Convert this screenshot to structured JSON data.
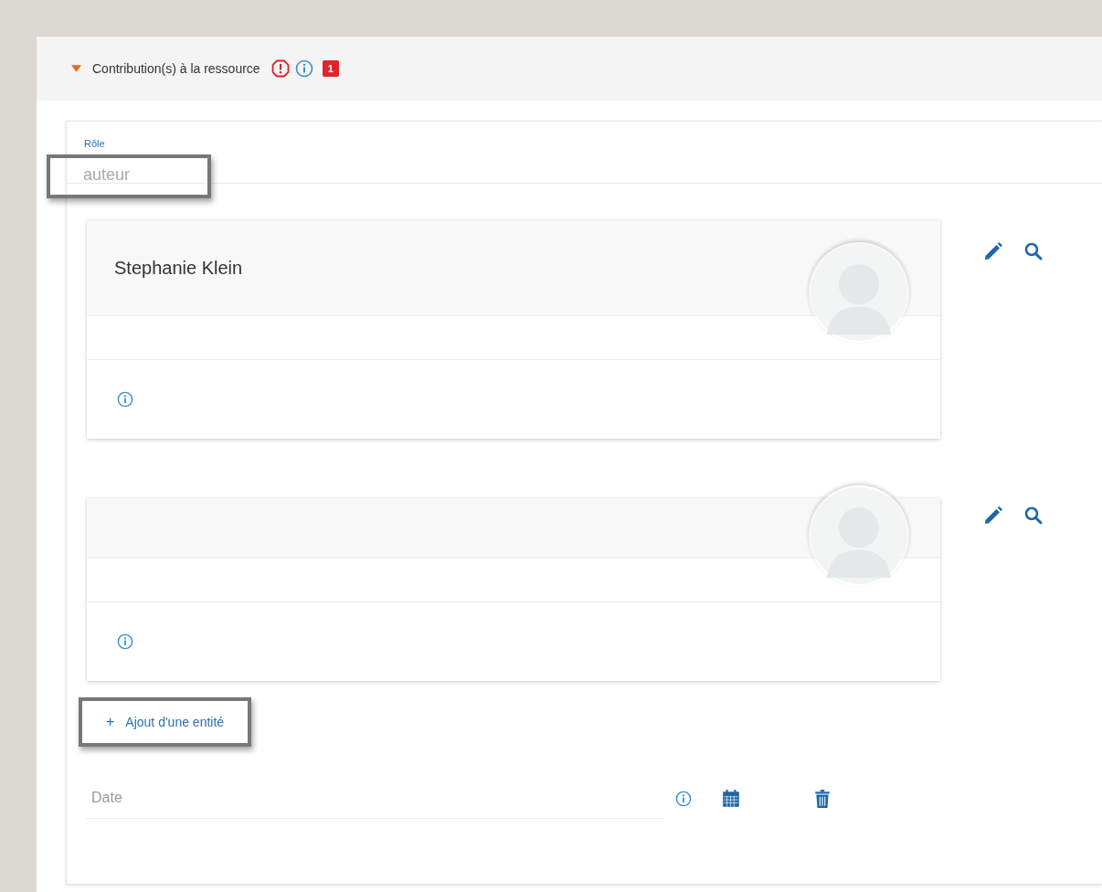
{
  "section": {
    "title": "Contribution(s) à la ressource",
    "expanded": true,
    "error_count": "1"
  },
  "role": {
    "label": "Rôle",
    "value": "auteur",
    "highlighted": true
  },
  "entities": [
    {
      "kind": "named",
      "name": "Stephanie Klein"
    },
    {
      "kind": "empty"
    }
  ],
  "add_button": {
    "icon": "+",
    "label": "Ajout d'une entité",
    "highlighted": true
  },
  "date": {
    "placeholder": "Date"
  }
}
